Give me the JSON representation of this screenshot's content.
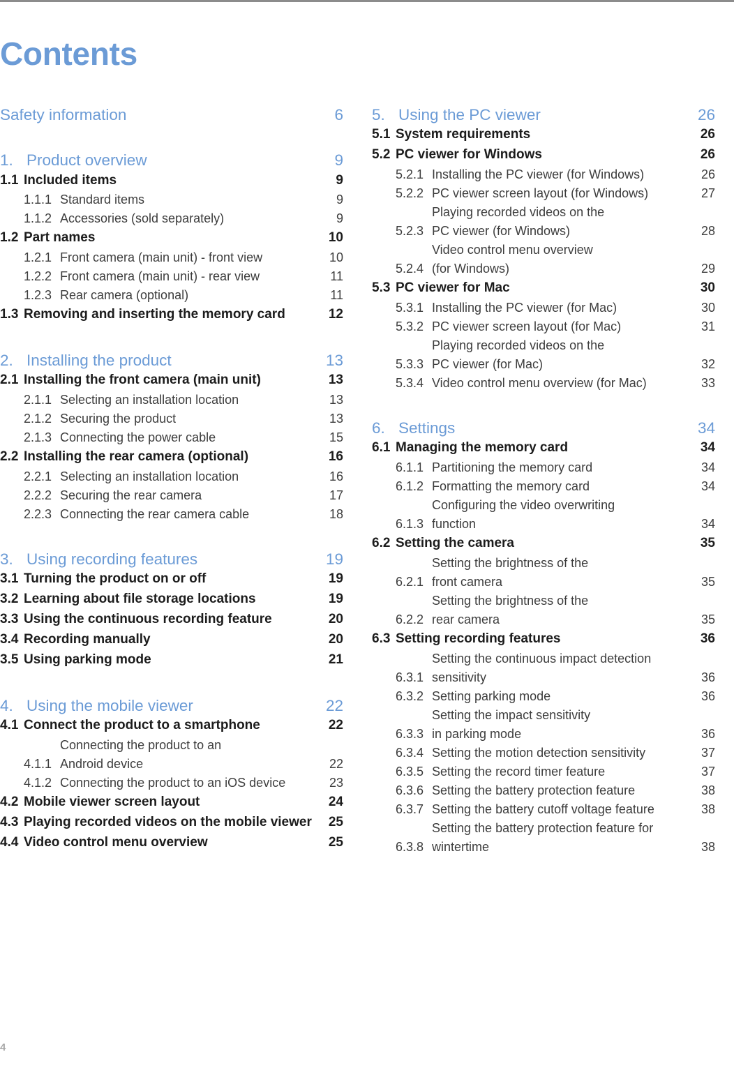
{
  "page": {
    "title": "Contents",
    "folio": "4"
  },
  "colors": {
    "accent_blue": "#6b9bd6",
    "body_dark": "#1c1c1c",
    "body_gray": "#3d3d3d",
    "folio_gray": "#a8a8a8",
    "rule_gray": "#8c8c8c"
  },
  "left_column": [
    {
      "level": 0,
      "num": "",
      "label": "Safety information",
      "page": "6"
    },
    {
      "level": 1,
      "num": "1.",
      "label": "Product overview",
      "page": "9"
    },
    {
      "level": 2,
      "num": "1.1",
      "label": "Included items",
      "page": "9"
    },
    {
      "level": 3,
      "num": "1.1.1",
      "label": "Standard items",
      "page": "9"
    },
    {
      "level": 3,
      "num": "1.1.2",
      "label": "Accessories (sold separately)",
      "page": "9"
    },
    {
      "level": 2,
      "num": "1.2",
      "label": "Part names",
      "page": "10"
    },
    {
      "level": 3,
      "num": "1.2.1",
      "label": "Front camera (main unit) - front view",
      "page": "10"
    },
    {
      "level": 3,
      "num": "1.2.2",
      "label": "Front camera (main unit) - rear view",
      "page": "11"
    },
    {
      "level": 3,
      "num": "1.2.3",
      "label": "Rear camera (optional)",
      "page": "11"
    },
    {
      "level": 2,
      "num": "1.3",
      "label": "Removing and inserting the memory card",
      "page": "12"
    },
    {
      "level": 1,
      "num": "2.",
      "label": "Installing the product",
      "page": "13"
    },
    {
      "level": 2,
      "num": "2.1",
      "label": "Installing the front camera (main unit)",
      "page": "13"
    },
    {
      "level": 3,
      "num": "2.1.1",
      "label": "Selecting an installation location",
      "page": "13"
    },
    {
      "level": 3,
      "num": "2.1.2",
      "label": "Securing the product",
      "page": "13"
    },
    {
      "level": 3,
      "num": "2.1.3",
      "label": "Connecting the power cable",
      "page": "15"
    },
    {
      "level": 2,
      "num": "2.2",
      "label": "Installing the rear camera (optional)",
      "page": "16"
    },
    {
      "level": 3,
      "num": "2.2.1",
      "label": "Selecting an installation location",
      "page": "16"
    },
    {
      "level": 3,
      "num": "2.2.2",
      "label": "Securing the rear camera",
      "page": "17"
    },
    {
      "level": 3,
      "num": "2.2.3",
      "label": "Connecting the rear camera cable",
      "page": "18"
    },
    {
      "level": 1,
      "num": "3.",
      "label": "Using recording features",
      "page": "19"
    },
    {
      "level": 2,
      "num": "3.1",
      "label": "Turning the product on or off",
      "page": "19"
    },
    {
      "level": 2,
      "num": "3.2",
      "label": "Learning about file storage locations",
      "page": "19"
    },
    {
      "level": 2,
      "num": "3.3",
      "label": "Using the continuous recording feature",
      "page": "20"
    },
    {
      "level": 2,
      "num": "3.4",
      "label": "Recording manually",
      "page": "20"
    },
    {
      "level": 2,
      "num": "3.5",
      "label": "Using parking mode",
      "page": "21"
    },
    {
      "level": 1,
      "num": "4.",
      "label": "Using the mobile viewer",
      "page": "22"
    },
    {
      "level": 2,
      "num": "4.1",
      "label": "Connect the product to a smartphone",
      "page": "22"
    },
    {
      "level": 3,
      "num": "4.1.1",
      "label": "Connecting the product to an",
      "label2": "Android device",
      "page": "22"
    },
    {
      "level": 3,
      "num": "4.1.2",
      "label": "Connecting the product to an iOS device",
      "page": "23"
    },
    {
      "level": 2,
      "num": "4.2",
      "label": "Mobile viewer screen layout",
      "page": "24"
    },
    {
      "level": 2,
      "num": "4.3",
      "label": "Playing recorded videos on the mobile viewer",
      "page": "25"
    },
    {
      "level": 2,
      "num": "4.4",
      "label": "Video control menu overview",
      "page": "25"
    }
  ],
  "right_column": [
    {
      "level": 1,
      "num": "5.",
      "label": "Using the PC viewer",
      "page": "26"
    },
    {
      "level": 2,
      "num": "5.1",
      "label": "System requirements",
      "page": "26"
    },
    {
      "level": 2,
      "num": "5.2",
      "label": "PC viewer for Windows",
      "page": "26"
    },
    {
      "level": 3,
      "num": "5.2.1",
      "label": "Installing the PC viewer (for Windows)",
      "page": "26"
    },
    {
      "level": 3,
      "num": "5.2.2",
      "label": "PC viewer screen layout (for Windows)",
      "page": "27"
    },
    {
      "level": 3,
      "num": "5.2.3",
      "label": "Playing recorded videos on the",
      "label2": "PC viewer (for Windows)",
      "page": "28"
    },
    {
      "level": 3,
      "num": "5.2.4",
      "label": "Video control menu overview",
      "label2": "(for Windows)",
      "page": "29"
    },
    {
      "level": 2,
      "num": "5.3",
      "label": "PC viewer for Mac",
      "page": "30"
    },
    {
      "level": 3,
      "num": "5.3.1",
      "label": "Installing the PC viewer (for Mac)",
      "page": "30"
    },
    {
      "level": 3,
      "num": "5.3.2",
      "label": "PC viewer screen layout (for Mac)",
      "page": "31"
    },
    {
      "level": 3,
      "num": "5.3.3",
      "label": "Playing recorded videos on the",
      "label2": "PC viewer (for Mac)",
      "page": "32"
    },
    {
      "level": 3,
      "num": "5.3.4",
      "label": "Video control menu overview (for Mac)",
      "page": "33"
    },
    {
      "level": 1,
      "num": "6.",
      "label": "Settings",
      "page": "34"
    },
    {
      "level": 2,
      "num": "6.1",
      "label": "Managing the memory card",
      "page": "34"
    },
    {
      "level": 3,
      "num": "6.1.1",
      "label": "Partitioning the memory card",
      "page": "34"
    },
    {
      "level": 3,
      "num": "6.1.2",
      "label": "Formatting the memory card",
      "page": "34"
    },
    {
      "level": 3,
      "num": "6.1.3",
      "label": "Configuring the video overwriting",
      "label2": "function",
      "page": "34"
    },
    {
      "level": 2,
      "num": "6.2",
      "label": "Setting the camera",
      "page": "35"
    },
    {
      "level": 3,
      "num": "6.2.1",
      "label": "Setting the brightness of the",
      "label2": "front camera",
      "page": "35"
    },
    {
      "level": 3,
      "num": "6.2.2",
      "label": "Setting the brightness of the",
      "label2": "rear camera",
      "page": "35"
    },
    {
      "level": 2,
      "num": "6.3",
      "label": "Setting recording features",
      "page": "36"
    },
    {
      "level": 3,
      "num": "6.3.1",
      "label": "Setting the continuous impact detection",
      "label2": "sensitivity",
      "page": "36"
    },
    {
      "level": 3,
      "num": "6.3.2",
      "label": "Setting parking mode",
      "page": "36"
    },
    {
      "level": 3,
      "num": "6.3.3",
      "label": "Setting the impact sensitivity",
      "label2": "in parking mode",
      "page": "36"
    },
    {
      "level": 3,
      "num": "6.3.4",
      "label": "Setting the motion detection sensitivity",
      "page": "37"
    },
    {
      "level": 3,
      "num": "6.3.5",
      "label": "Setting the record timer feature",
      "page": "37"
    },
    {
      "level": 3,
      "num": "6.3.6",
      "label": "Setting the battery protection feature",
      "page": "38"
    },
    {
      "level": 3,
      "num": "6.3.7",
      "label": "Setting the battery cutoff voltage feature",
      "page": "38"
    },
    {
      "level": 3,
      "num": "6.3.8",
      "label": "Setting the battery protection feature for",
      "label2": "wintertime",
      "page": "38"
    }
  ]
}
